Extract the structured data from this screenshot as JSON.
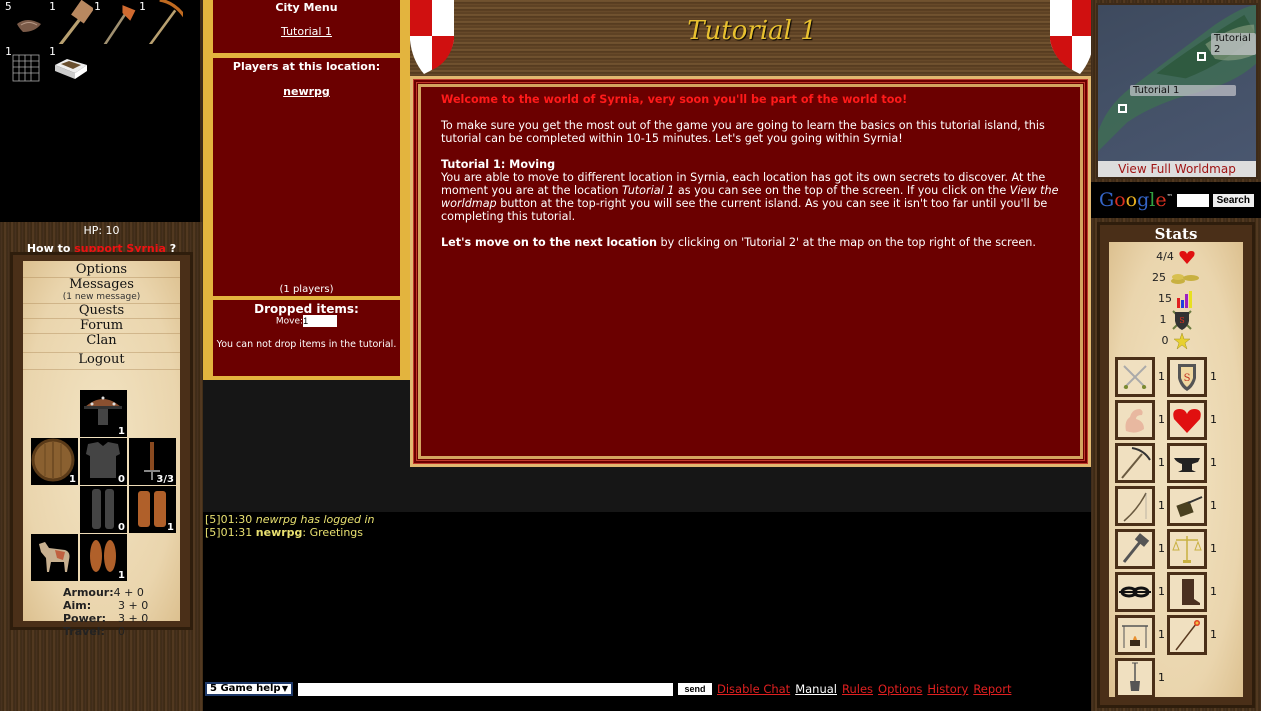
{
  "inventory": [
    {
      "name": "bait",
      "count": "5"
    },
    {
      "name": "hammer",
      "count": "1"
    },
    {
      "name": "hatchet",
      "count": "1"
    },
    {
      "name": "pickaxe",
      "count": "1"
    },
    {
      "name": "net",
      "count": "1"
    },
    {
      "name": "small-box",
      "count": "1"
    }
  ],
  "player": {
    "hp_label": "HP: 10",
    "support_prefix": "How to ",
    "support_link": "support Syrnia",
    "support_suffix": " ?"
  },
  "menu": {
    "items": [
      "Options",
      "Messages",
      "Quests",
      "Forum",
      "Clan",
      "Logout"
    ],
    "messages_note": "(1 new message)"
  },
  "equipment": {
    "helmet": "1",
    "shield": "1",
    "body": "0",
    "weapon": "3/3",
    "legs": "0",
    "gloves": "1",
    "horse": "",
    "boots": "1"
  },
  "combat_stats": [
    {
      "label": "Armour:",
      "value": "4 + 0"
    },
    {
      "label": "Aim:",
      "value": "3 + 0"
    },
    {
      "label": "Power:",
      "value": "3 + 0"
    },
    {
      "label": "Travel:",
      "value": "0"
    }
  ],
  "city": {
    "menu_title": "City Menu",
    "location_link": "Tutorial 1",
    "players_title": "Players at this location:",
    "player_name": "newrpg",
    "player_count": "(1 players)",
    "dropped_title": "Dropped items:",
    "move_label": "Move:",
    "move_value": "1",
    "drop_note": "You can not drop items in the tutorial."
  },
  "header": {
    "title": "Tutorial 1"
  },
  "tutorial": {
    "welcome": "Welcome to the world of Syrnia, very soon you'll be part of the world too!",
    "intro": "To make sure you get the most out of the game you are going to learn the basics on this tutorial island, this tutorial can be completed within 10-15 minutes. Let's get you going within Syrnia!",
    "section_title": "Tutorial 1: Moving",
    "body_1": "You are able to move to different location in Syrnia, each location has got its own secrets to discover. At the moment you are at the location ",
    "body_loc": "Tutorial 1",
    "body_2": " as you can see on the top of the screen. If you click on the ",
    "body_btn": "View the worldmap",
    "body_3": " button at the top-right you will see the current island. As you can see it isn't too far until you'll be completing this tutorial.",
    "cta_bold": "Let's move on to the next location",
    "cta_rest": " by clicking on 'Tutorial 2' at the map on the top right of the screen."
  },
  "chat": {
    "lines": [
      {
        "prefix": "[5]01:30 ",
        "user": "newrpg",
        "text": " has logged in",
        "type": "system"
      },
      {
        "prefix": "[5]01:31 ",
        "user": "newrpg",
        "text": ": Greetings",
        "type": "message"
      }
    ],
    "channel": "5 Game help",
    "input_value": "",
    "send_label": "send",
    "links": [
      "Disable Chat",
      "Manual",
      "Rules",
      "Options",
      "History",
      "Report"
    ]
  },
  "map": {
    "labels": [
      "Tutorial 2",
      "Tutorial 1"
    ],
    "view_full": "View Full Worldmap"
  },
  "search": {
    "brand": "Google",
    "button": "Search",
    "value": ""
  },
  "stats": {
    "title": "Stats",
    "rows": [
      {
        "value": "4/4",
        "icon": "heart"
      },
      {
        "value": "25",
        "icon": "gold"
      },
      {
        "value": "15",
        "icon": "level-bars"
      },
      {
        "value": "1",
        "icon": "combat-shield"
      },
      {
        "value": "0",
        "icon": "star"
      }
    ],
    "skills": [
      {
        "name": "attack",
        "level": "1"
      },
      {
        "name": "defence",
        "level": "1"
      },
      {
        "name": "strength",
        "level": "1"
      },
      {
        "name": "health",
        "level": "1"
      },
      {
        "name": "mining",
        "level": "1"
      },
      {
        "name": "smithing",
        "level": "1"
      },
      {
        "name": "woodcutting",
        "level": "1"
      },
      {
        "name": "constructing",
        "level": "1"
      },
      {
        "name": "fishing",
        "level": "1"
      },
      {
        "name": "trading",
        "level": "1"
      },
      {
        "name": "thieving",
        "level": "1"
      },
      {
        "name": "speed",
        "level": "1"
      },
      {
        "name": "cooking",
        "level": "1"
      },
      {
        "name": "magic",
        "level": "1"
      },
      {
        "name": "farming",
        "level": "1"
      }
    ]
  }
}
